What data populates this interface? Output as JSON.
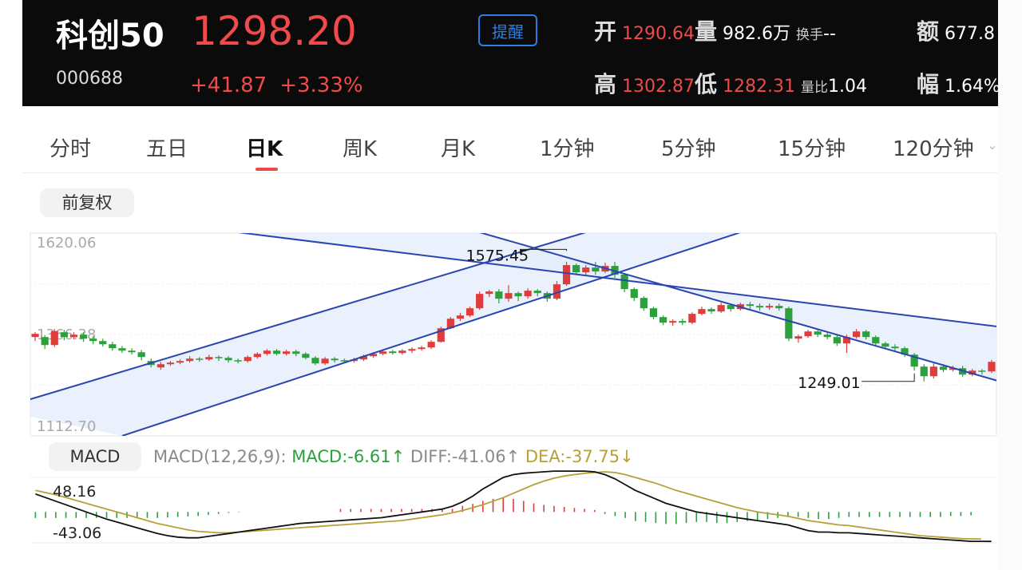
{
  "header": {
    "name": "科创50",
    "code": "000688",
    "price": "1298.20",
    "change": "+41.87",
    "change_pct": "+3.33%",
    "remind_label": "提醒",
    "open_label": "开",
    "open": "1290.64",
    "vol_label": "量",
    "vol": "982.6万",
    "turnover_label": "换手",
    "turnover": "--",
    "amount_label": "额",
    "amount": "677.8",
    "high_label": "高",
    "high": "1302.87",
    "low_label": "低",
    "low": "1282.31",
    "vr_label": "量比",
    "vr": "1.04",
    "amp_label": "幅",
    "amp": "1.64%"
  },
  "tabs": [
    "分时",
    "五日",
    "日K",
    "周K",
    "月K",
    "1分钟",
    "5分钟",
    "15分钟",
    "120分钟"
  ],
  "adjust_label": "前复权",
  "colors": {
    "up": "#e03c3c",
    "down": "#2ca03c",
    "trend": "#2a45b0",
    "band": "#e3ecfb",
    "dif": "#111111",
    "dea": "#b8a038"
  },
  "chart_data": {
    "type": "candlestick",
    "y_ticks": [
      "1620.06",
      "1366.38",
      "1112.70"
    ],
    "ylim": [
      1112.7,
      1620.06
    ],
    "annotations": [
      {
        "label": "1575.45",
        "value": 1575.45,
        "index": 55
      },
      {
        "label": "1249.01",
        "value": 1249.01,
        "index": 91
      }
    ],
    "candles": [
      [
        1360,
        1368,
        1350,
        1372
      ],
      [
        1360,
        1340,
        1330,
        1365
      ],
      [
        1340,
        1375,
        1335,
        1380
      ],
      [
        1372,
        1360,
        1352,
        1378
      ],
      [
        1360,
        1366,
        1354,
        1372
      ],
      [
        1366,
        1356,
        1348,
        1372
      ],
      [
        1356,
        1350,
        1342,
        1362
      ],
      [
        1350,
        1342,
        1336,
        1356
      ],
      [
        1342,
        1332,
        1326,
        1348
      ],
      [
        1332,
        1326,
        1320,
        1338
      ],
      [
        1326,
        1322,
        1316,
        1332
      ],
      [
        1322,
        1310,
        1302,
        1328
      ],
      [
        1300,
        1290,
        1284,
        1306
      ],
      [
        1284,
        1292,
        1278,
        1298
      ],
      [
        1292,
        1296,
        1288,
        1300
      ],
      [
        1296,
        1300,
        1292,
        1304
      ],
      [
        1300,
        1306,
        1296,
        1312
      ],
      [
        1306,
        1304,
        1298,
        1310
      ],
      [
        1304,
        1310,
        1300,
        1316
      ],
      [
        1310,
        1308,
        1300,
        1314
      ],
      [
        1308,
        1302,
        1296,
        1312
      ],
      [
        1302,
        1300,
        1294,
        1306
      ],
      [
        1300,
        1310,
        1296,
        1314
      ],
      [
        1310,
        1318,
        1306,
        1322
      ],
      [
        1318,
        1326,
        1314,
        1330
      ],
      [
        1326,
        1318,
        1314,
        1330
      ],
      [
        1318,
        1324,
        1314,
        1328
      ],
      [
        1324,
        1318,
        1312,
        1328
      ],
      [
        1318,
        1308,
        1304,
        1322
      ],
      [
        1308,
        1294,
        1290,
        1312
      ],
      [
        1294,
        1306,
        1290,
        1310
      ],
      [
        1306,
        1302,
        1296,
        1310
      ],
      [
        1302,
        1300,
        1296,
        1306
      ],
      [
        1300,
        1304,
        1296,
        1308
      ],
      [
        1304,
        1312,
        1300,
        1316
      ],
      [
        1312,
        1318,
        1308,
        1322
      ],
      [
        1318,
        1324,
        1314,
        1328
      ],
      [
        1324,
        1320,
        1316,
        1328
      ],
      [
        1320,
        1326,
        1316,
        1330
      ],
      [
        1326,
        1330,
        1320,
        1334
      ],
      [
        1330,
        1334,
        1326,
        1338
      ],
      [
        1334,
        1348,
        1330,
        1352
      ],
      [
        1348,
        1382,
        1346,
        1386
      ],
      [
        1382,
        1406,
        1380,
        1410
      ],
      [
        1406,
        1414,
        1400,
        1420
      ],
      [
        1414,
        1432,
        1410,
        1436
      ],
      [
        1432,
        1468,
        1428,
        1474
      ],
      [
        1468,
        1474,
        1460,
        1478
      ],
      [
        1474,
        1456,
        1444,
        1480
      ],
      [
        1456,
        1470,
        1448,
        1490
      ],
      [
        1470,
        1462,
        1450,
        1474
      ],
      [
        1462,
        1476,
        1456,
        1482
      ],
      [
        1476,
        1470,
        1462,
        1480
      ],
      [
        1470,
        1456,
        1448,
        1474
      ],
      [
        1456,
        1492,
        1452,
        1500
      ],
      [
        1492,
        1540,
        1488,
        1548
      ],
      [
        1540,
        1522,
        1516,
        1544
      ],
      [
        1522,
        1534,
        1516,
        1540
      ],
      [
        1534,
        1524,
        1516,
        1548
      ],
      [
        1524,
        1538,
        1520,
        1546
      ],
      [
        1538,
        1516,
        1508,
        1548
      ],
      [
        1516,
        1480,
        1472,
        1520
      ],
      [
        1480,
        1458,
        1450,
        1484
      ],
      [
        1458,
        1432,
        1426,
        1462
      ],
      [
        1432,
        1410,
        1404,
        1436
      ],
      [
        1410,
        1396,
        1390,
        1414
      ],
      [
        1396,
        1400,
        1388,
        1404
      ],
      [
        1400,
        1396,
        1390,
        1406
      ],
      [
        1396,
        1418,
        1392,
        1422
      ],
      [
        1418,
        1430,
        1414,
        1436
      ],
      [
        1430,
        1424,
        1418,
        1434
      ],
      [
        1424,
        1440,
        1420,
        1446
      ],
      [
        1440,
        1430,
        1424,
        1444
      ],
      [
        1430,
        1442,
        1426,
        1446
      ],
      [
        1442,
        1438,
        1430,
        1448
      ],
      [
        1438,
        1434,
        1426,
        1444
      ],
      [
        1434,
        1438,
        1428,
        1444
      ],
      [
        1438,
        1432,
        1426,
        1444
      ],
      [
        1432,
        1356,
        1350,
        1436
      ],
      [
        1356,
        1362,
        1346,
        1366
      ],
      [
        1362,
        1374,
        1358,
        1378
      ],
      [
        1374,
        1366,
        1360,
        1378
      ],
      [
        1366,
        1360,
        1354,
        1372
      ],
      [
        1360,
        1344,
        1338,
        1364
      ],
      [
        1344,
        1360,
        1320,
        1366
      ],
      [
        1360,
        1374,
        1356,
        1380
      ],
      [
        1374,
        1360,
        1354,
        1378
      ],
      [
        1360,
        1344,
        1338,
        1364
      ],
      [
        1344,
        1336,
        1330,
        1348
      ],
      [
        1336,
        1332,
        1326,
        1342
      ],
      [
        1332,
        1316,
        1310,
        1336
      ],
      [
        1316,
        1286,
        1276,
        1320
      ],
      [
        1286,
        1262,
        1249.01,
        1292
      ],
      [
        1262,
        1286,
        1256,
        1294
      ],
      [
        1286,
        1278,
        1272,
        1292
      ],
      [
        1278,
        1282,
        1274,
        1288
      ],
      [
        1282,
        1266,
        1260,
        1288
      ],
      [
        1266,
        1276,
        1262,
        1280
      ],
      [
        1276,
        1274,
        1266,
        1280
      ],
      [
        1274,
        1298,
        1270,
        1302.87
      ]
    ],
    "trend_lines": [
      {
        "from": {
          "index": -4,
          "value": 1179
        },
        "to": {
          "index": 57,
          "value": 1622
        }
      },
      {
        "from": {
          "index": 9,
          "value": 1112.7
        },
        "to": {
          "index": 73,
          "value": 1622
        }
      },
      {
        "from": {
          "index": 21,
          "value": 1622
        },
        "to": {
          "index": 100,
          "value": 1385
        }
      },
      {
        "from": {
          "index": 46,
          "value": 1622
        },
        "to": {
          "index": 100,
          "value": 1248
        }
      }
    ],
    "macd": {
      "label": "MACD",
      "params": "MACD(12,26,9):",
      "macd_value": "MACD:-6.61↑",
      "diff_value": "DIFF:-41.06↑",
      "dea_value": "DEA:-37.75↓",
      "y_ticks": [
        "48.16",
        "-43.06"
      ],
      "ylim": [
        -43.06,
        48.16
      ],
      "diff": [
        25,
        20,
        15,
        10,
        5,
        0,
        -5,
        -10,
        -14,
        -18,
        -22,
        -26,
        -30,
        -33,
        -35,
        -36,
        -36,
        -34,
        -32,
        -30,
        -28,
        -26,
        -24,
        -22,
        -20,
        -18,
        -16,
        -15,
        -14,
        -13,
        -12,
        -11,
        -10,
        -9,
        -8,
        -6,
        -4,
        -2,
        0,
        2,
        4,
        8,
        14,
        22,
        32,
        40,
        48,
        52,
        54,
        55,
        56,
        57,
        57,
        57,
        57,
        56,
        52,
        46,
        38,
        30,
        24,
        18,
        12,
        8,
        4,
        0,
        -2,
        -4,
        -6,
        -8,
        -10,
        -12,
        -14,
        -16,
        -18,
        -22,
        -26,
        -28,
        -28,
        -29,
        -29,
        -30,
        -31,
        -32,
        -33,
        -34,
        -35,
        -36,
        -37,
        -38,
        -39,
        -40,
        -41,
        -41,
        -41.06
      ],
      "dea": [
        30,
        27,
        24,
        20,
        16,
        12,
        8,
        4,
        0,
        -4,
        -8,
        -12,
        -16,
        -19,
        -22,
        -25,
        -27,
        -28,
        -29,
        -29,
        -28,
        -27,
        -26,
        -25,
        -24,
        -23,
        -22,
        -21,
        -20,
        -19,
        -18,
        -17,
        -16,
        -15,
        -14,
        -13,
        -12,
        -10,
        -8,
        -6,
        -4,
        -1,
        2,
        6,
        10,
        15,
        20,
        26,
        32,
        38,
        43,
        47,
        50,
        52,
        54,
        55,
        56,
        55,
        52,
        48,
        44,
        40,
        35,
        30,
        26,
        22,
        18,
        14,
        10,
        6,
        3,
        0,
        -2,
        -4,
        -6,
        -9,
        -12,
        -14,
        -16,
        -18,
        -19,
        -21,
        -23,
        -25,
        -27,
        -29,
        -31,
        -33,
        -34,
        -35,
        -36,
        -37,
        -37.5,
        -37.75
      ],
      "hist": [
        -12,
        -12,
        -12,
        -12,
        -12,
        -12,
        -12,
        -12,
        -12,
        -12,
        -12,
        -12,
        -12,
        -11,
        -10,
        -9,
        -8,
        -6,
        -4,
        -2,
        -1,
        0,
        0,
        0,
        0,
        0,
        0,
        0,
        0,
        0,
        6,
        6,
        6,
        6,
        6,
        6,
        6,
        6,
        6,
        6,
        6,
        6,
        12,
        16,
        22,
        26,
        28,
        26,
        22,
        17,
        14,
        12,
        10,
        8,
        6,
        4,
        -4,
        -8,
        -12,
        -18,
        -20,
        -22,
        -24,
        -24,
        -22,
        -20,
        -20,
        -22,
        -22,
        -20,
        -18,
        -16,
        -14,
        -12,
        -10,
        -10,
        -12,
        -14,
        -14,
        -12,
        -10,
        -10,
        -10,
        -10,
        -10,
        -10,
        -10,
        -10,
        -10,
        -10,
        -8,
        -8,
        -6.61
      ]
    }
  }
}
